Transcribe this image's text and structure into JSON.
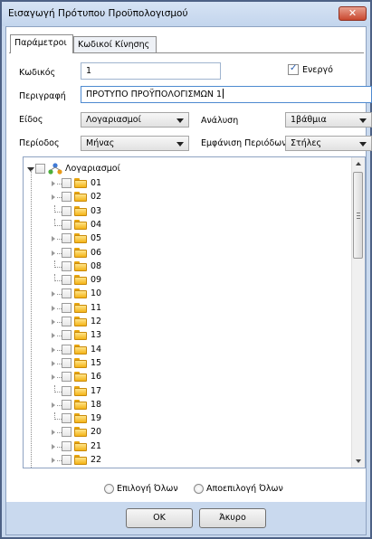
{
  "window": {
    "title": "Εισαγωγή Πρότυπου Προϋπολογισμού",
    "close_glyph": "✕"
  },
  "tabs": [
    {
      "label": "Παράμετροι"
    },
    {
      "label": "Κωδικοί Κίνησης"
    }
  ],
  "form": {
    "code_label": "Κωδικός",
    "code_value": "1",
    "active_label": "Ενεργό",
    "active_checked": true,
    "description_label": "Περιγραφή",
    "description_value": "ΠΡΟΤΥΠΟ ΠΡΟΫΠΟΛΟΓΙΣΜΩΝ 1",
    "type_label": "Είδος",
    "type_value": "Λογαριασμοί",
    "analysis_label": "Ανάλυση",
    "analysis_value": "1βάθμια",
    "period_label": "Περίοδος",
    "period_value": "Μήνας",
    "period_display_label": "Εμφάνιση Περιόδων",
    "period_display_value": "Στήλες"
  },
  "tree": {
    "root_label": "Λογαριασμοί",
    "items": [
      {
        "label": "01",
        "expandable": true
      },
      {
        "label": "02",
        "expandable": true
      },
      {
        "label": "03",
        "expandable": false
      },
      {
        "label": "04",
        "expandable": false
      },
      {
        "label": "05",
        "expandable": true
      },
      {
        "label": "06",
        "expandable": true
      },
      {
        "label": "08",
        "expandable": false
      },
      {
        "label": "09",
        "expandable": false
      },
      {
        "label": "10",
        "expandable": true
      },
      {
        "label": "11",
        "expandable": true
      },
      {
        "label": "12",
        "expandable": true
      },
      {
        "label": "13",
        "expandable": true
      },
      {
        "label": "14",
        "expandable": true
      },
      {
        "label": "15",
        "expandable": true
      },
      {
        "label": "16",
        "expandable": true
      },
      {
        "label": "17",
        "expandable": false
      },
      {
        "label": "18",
        "expandable": true
      },
      {
        "label": "19",
        "expandable": false
      },
      {
        "label": "20",
        "expandable": true
      },
      {
        "label": "21",
        "expandable": true
      },
      {
        "label": "22",
        "expandable": true
      },
      {
        "label": "",
        "expandable": true
      }
    ]
  },
  "selection": {
    "select_all_label": "Επιλογή Όλων",
    "deselect_all_label": "Αποεπιλογή Όλων"
  },
  "buttons": {
    "ok_label": "OK",
    "cancel_label": "Άκυρο"
  },
  "colors": {
    "frame": "#4d6185",
    "panel": "#c9d9ee",
    "close_button": "#c9482f",
    "folder": "#f4b316",
    "checkmark": "#2a5eb0"
  }
}
